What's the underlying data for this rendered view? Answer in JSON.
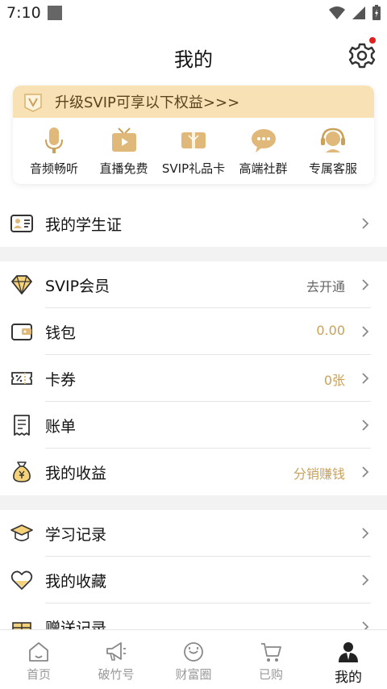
{
  "status_bar": {
    "time": "7:10"
  },
  "header": {
    "title": "我的"
  },
  "vip_card": {
    "banner_text": "升级SVIP可享以下权益>>>",
    "benefits": [
      {
        "label": "音频畅听",
        "icon": "microphone-icon"
      },
      {
        "label": "直播免费",
        "icon": "tv-icon"
      },
      {
        "label": "SVIP礼品卡",
        "icon": "gift-card-icon"
      },
      {
        "label": "高端社群",
        "icon": "chat-bubble-icon"
      },
      {
        "label": "专属客服",
        "icon": "headset-icon"
      }
    ]
  },
  "student": {
    "label": "我的学生证",
    "icon": "id-card-icon"
  },
  "account": {
    "items": [
      {
        "label": "SVIP会员",
        "value": "去开通",
        "icon": "diamond-icon"
      },
      {
        "label": "钱包",
        "value": "0.00",
        "icon": "wallet-icon"
      },
      {
        "label": "卡券",
        "value": "0张",
        "icon": "coupon-icon"
      },
      {
        "label": "账单",
        "value": "",
        "icon": "bill-icon"
      },
      {
        "label": "我的收益",
        "value": "分销赚钱",
        "icon": "money-bag-icon"
      }
    ]
  },
  "records": {
    "items": [
      {
        "label": "学习记录",
        "icon": "graduation-cap-icon"
      },
      {
        "label": "我的收藏",
        "icon": "heart-icon"
      },
      {
        "label": "赠送记录",
        "icon": "gift-icon"
      }
    ]
  },
  "tabbar": {
    "tabs": [
      {
        "label": "首页",
        "icon": "home-icon"
      },
      {
        "label": "破竹号",
        "icon": "megaphone-icon"
      },
      {
        "label": "财富圈",
        "icon": "circle-icon"
      },
      {
        "label": "已购",
        "icon": "cart-icon"
      },
      {
        "label": "我的",
        "icon": "user-icon",
        "active": true
      }
    ]
  },
  "colors": {
    "gold": "#c9a15a",
    "banner": "#f8e1b4",
    "badge_red": "#e02020"
  }
}
